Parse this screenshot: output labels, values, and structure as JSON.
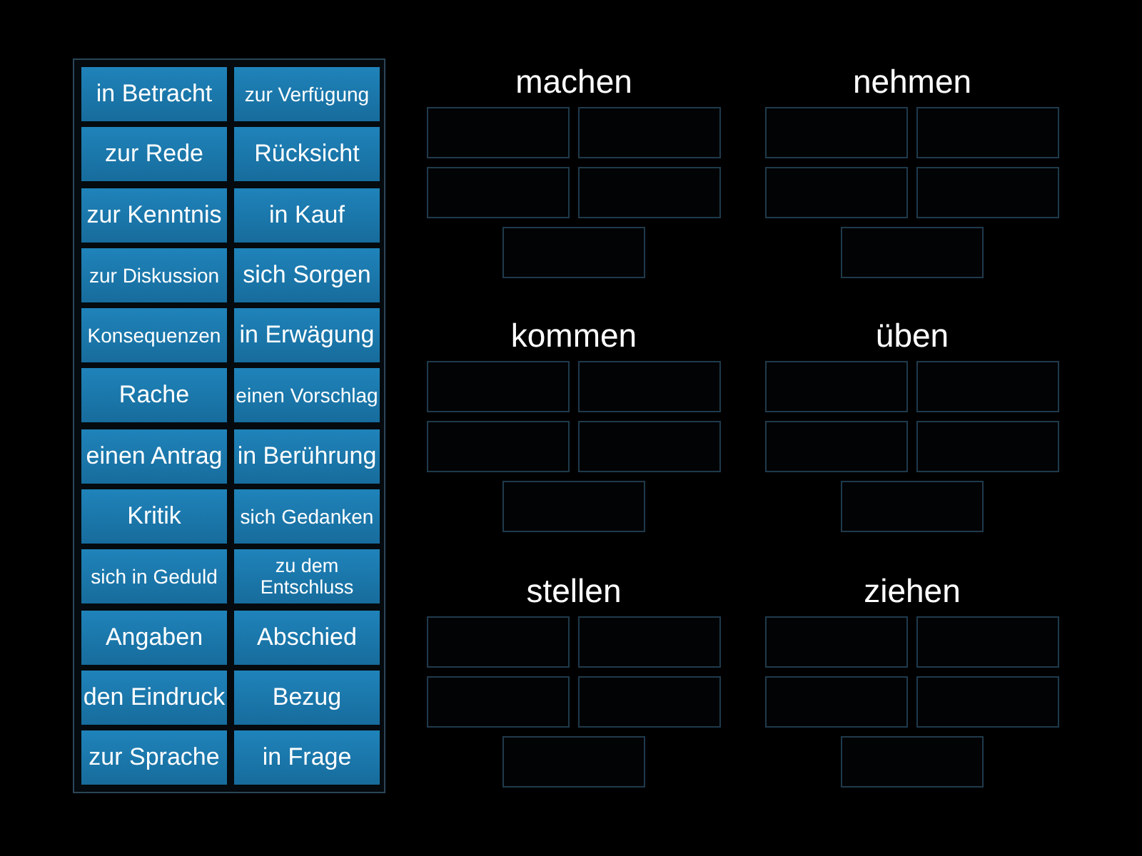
{
  "cards": [
    {
      "text": "in Betracht"
    },
    {
      "text": "zur Verfügung"
    },
    {
      "text": "zur Rede"
    },
    {
      "text": "Rücksicht"
    },
    {
      "text": "zur Kenntnis"
    },
    {
      "text": "in Kauf"
    },
    {
      "text": "zur Diskussion"
    },
    {
      "text": "sich Sorgen"
    },
    {
      "text": "Konsequenzen"
    },
    {
      "text": "in Erwägung"
    },
    {
      "text": "Rache"
    },
    {
      "text": "einen Vorschlag"
    },
    {
      "text": "einen Antrag"
    },
    {
      "text": "in Berührung"
    },
    {
      "text": "Kritik"
    },
    {
      "text": "sich Gedanken"
    },
    {
      "text": "sich in Geduld"
    },
    {
      "text": "zu dem Entschluss"
    },
    {
      "text": "Angaben"
    },
    {
      "text": "Abschied"
    },
    {
      "text": "den Eindruck"
    },
    {
      "text": "Bezug"
    },
    {
      "text": "zur Sprache"
    },
    {
      "text": "in Frage"
    }
  ],
  "groups": [
    {
      "title": "machen"
    },
    {
      "title": "nehmen"
    },
    {
      "title": "kommen"
    },
    {
      "title": "üben"
    },
    {
      "title": "stellen"
    },
    {
      "title": "ziehen"
    }
  ]
}
